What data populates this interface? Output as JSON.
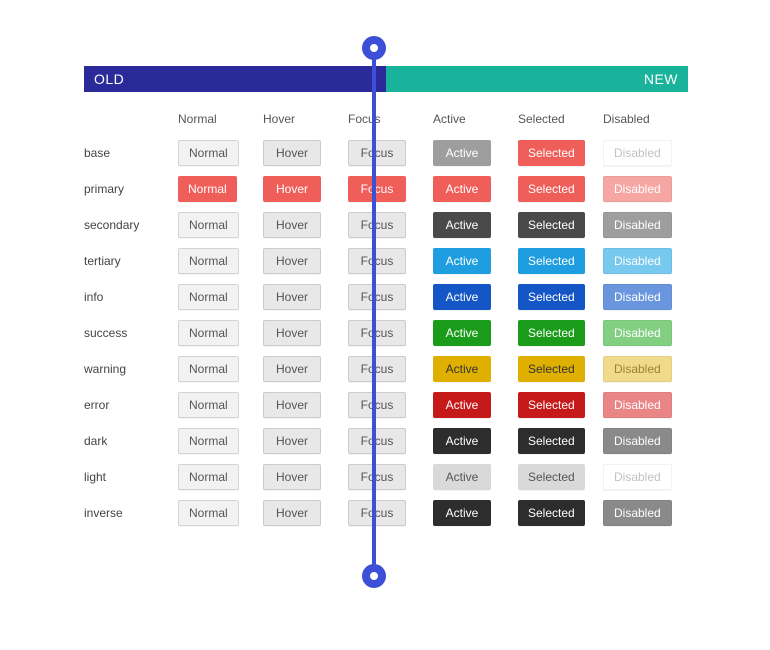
{
  "header": {
    "old": "OLD",
    "new": "NEW"
  },
  "columns": [
    "Normal",
    "Hover",
    "Focus",
    "Active",
    "Selected",
    "Disabled"
  ],
  "rows": [
    {
      "label": "base",
      "active": "#9e9e9e",
      "selected": "#f05e5a",
      "disabledBg": "#ffffff",
      "disabledColor": "#c2c2c2"
    },
    {
      "label": "primary",
      "allRed": true,
      "active": "#f05e5a",
      "selected": "#f05e5a",
      "disabledBg": "#f6a7a4",
      "disabledColor": "#ffffff"
    },
    {
      "label": "secondary",
      "active": "#4a4a4a",
      "selected": "#4a4a4a",
      "disabledBg": "#9e9e9e",
      "disabledColor": "#ffffff"
    },
    {
      "label": "tertiary",
      "active": "#1e9de0",
      "selected": "#1e9de0",
      "disabledBg": "#78c9ef",
      "disabledColor": "#ffffff"
    },
    {
      "label": "info",
      "active": "#1556c6",
      "selected": "#1556c6",
      "disabledBg": "#6a96df",
      "disabledColor": "#ffffff"
    },
    {
      "label": "success",
      "active": "#1a9c1a",
      "selected": "#1a9c1a",
      "disabledBg": "#82cf82",
      "disabledColor": "#ffffff"
    },
    {
      "label": "warning",
      "active": "#e0b000",
      "activeText": "#333333",
      "selected": "#e0b000",
      "selectedText": "#333333",
      "disabledBg": "#f0db8a",
      "disabledColor": "#9a8430"
    },
    {
      "label": "error",
      "active": "#c61a1a",
      "selected": "#c61a1a",
      "disabledBg": "#ea8585",
      "disabledColor": "#ffffff"
    },
    {
      "label": "dark",
      "active": "#2d2d2d",
      "selected": "#2d2d2d",
      "disabledBg": "#8a8a8a",
      "disabledColor": "#ffffff"
    },
    {
      "label": "light",
      "active": "#d9d9d9",
      "activeText": "#555555",
      "selected": "#d9d9d9",
      "selectedText": "#555555",
      "disabledBg": "#ffffff",
      "disabledColor": "#c2c2c2"
    },
    {
      "label": "inverse",
      "active": "#2d2d2d",
      "selected": "#2d2d2d",
      "disabledBg": "#8a8a8a",
      "disabledColor": "#ffffff"
    }
  ],
  "buttonLabels": {
    "normal": "Normal",
    "hover": "Hover",
    "focus": "Focus",
    "active": "Active",
    "selected": "Selected",
    "disabled": "Disabled"
  },
  "primaryRed": "#f05e5a"
}
